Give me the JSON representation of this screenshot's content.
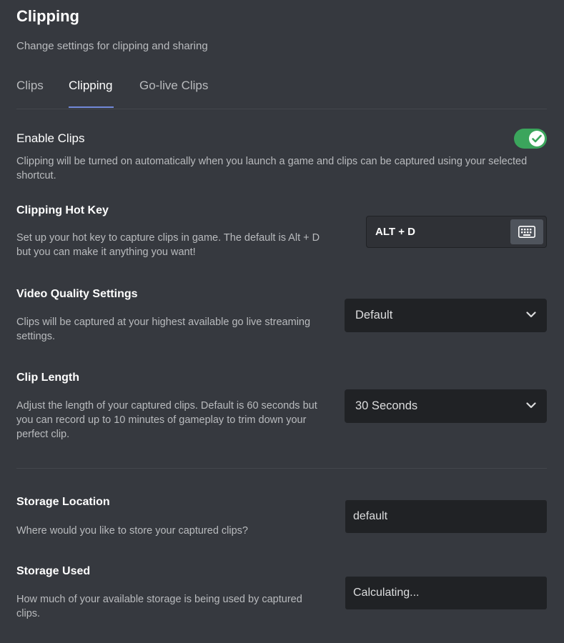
{
  "header": {
    "title": "Clipping",
    "subtitle": "Change settings for clipping and sharing"
  },
  "tabs": [
    {
      "label": "Clips",
      "active": false
    },
    {
      "label": "Clipping",
      "active": true
    },
    {
      "label": "Go-live Clips",
      "active": false
    }
  ],
  "enable_clips": {
    "title": "Enable Clips",
    "description": "Clipping will be turned on automatically when you launch a game and clips can be captured using your selected shortcut.",
    "enabled": true
  },
  "hotkey": {
    "title": "Clipping Hot Key",
    "description": "Set up your hot key to capture clips in game. The default is Alt + D but you can make it anything you want!",
    "value": "ALT + D",
    "icon": "keyboard-icon"
  },
  "video_quality": {
    "title": "Video Quality Settings",
    "description": "Clips will be captured at your highest available go live streaming settings.",
    "selected": "Default"
  },
  "clip_length": {
    "title": "Clip Length",
    "description": "Adjust the length of your captured clips. Default is 60 seconds but you can record up to 10 minutes of gameplay to trim down your perfect clip.",
    "selected": "30 Seconds"
  },
  "storage_location": {
    "title": "Storage Location",
    "description": "Where would you like to store your captured clips?",
    "value": "default"
  },
  "storage_used": {
    "title": "Storage Used",
    "description": "How much of your available storage is being used by captured clips.",
    "value": "Calculating..."
  },
  "colors": {
    "background": "#36393f",
    "toggle_on": "#3ba55c",
    "tab_accent": "#7289da",
    "input_bg": "#202225"
  }
}
